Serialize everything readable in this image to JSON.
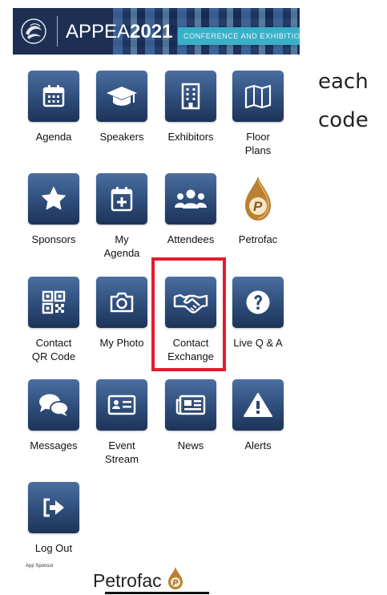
{
  "header": {
    "title_prefix": "APPEA",
    "title_year": "2021",
    "subtitle": "CONFERENCE AND EXHIBITION"
  },
  "side_text": [
    "each",
    "code"
  ],
  "tiles": [
    {
      "label": "Agenda",
      "icon": "calendar-icon"
    },
    {
      "label": "Speakers",
      "icon": "graduation-cap-icon"
    },
    {
      "label": "Exhibitors",
      "icon": "building-icon"
    },
    {
      "label": "Floor\nPlans",
      "icon": "map-icon"
    },
    {
      "label": "Sponsors",
      "icon": "star-icon"
    },
    {
      "label": "My\nAgenda",
      "icon": "calendar-plus-icon"
    },
    {
      "label": "Attendees",
      "icon": "users-icon"
    },
    {
      "label": "Petrofac",
      "icon": "petrofac-drop-icon"
    },
    {
      "label": "Contact\nQR Code",
      "icon": "qr-code-icon"
    },
    {
      "label": "My Photo",
      "icon": "camera-icon"
    },
    {
      "label": "Contact\nExchange",
      "icon": "handshake-icon"
    },
    {
      "label": "Live Q & A",
      "icon": "question-circle-icon"
    },
    {
      "label": "Messages",
      "icon": "chat-bubbles-icon"
    },
    {
      "label": "Event\nStream",
      "icon": "id-card-icon"
    },
    {
      "label": "News",
      "icon": "newspaper-icon"
    },
    {
      "label": "Alerts",
      "icon": "warning-icon"
    },
    {
      "label": "Log Out",
      "icon": "logout-icon"
    }
  ],
  "highlighted_tile": "Contact\nExchange",
  "highlight_color": "#e8192e",
  "tile_color": "#2e4c7a",
  "footer": {
    "sponsor_label": "App Sponsor",
    "sponsor_name": "Petrofac"
  }
}
